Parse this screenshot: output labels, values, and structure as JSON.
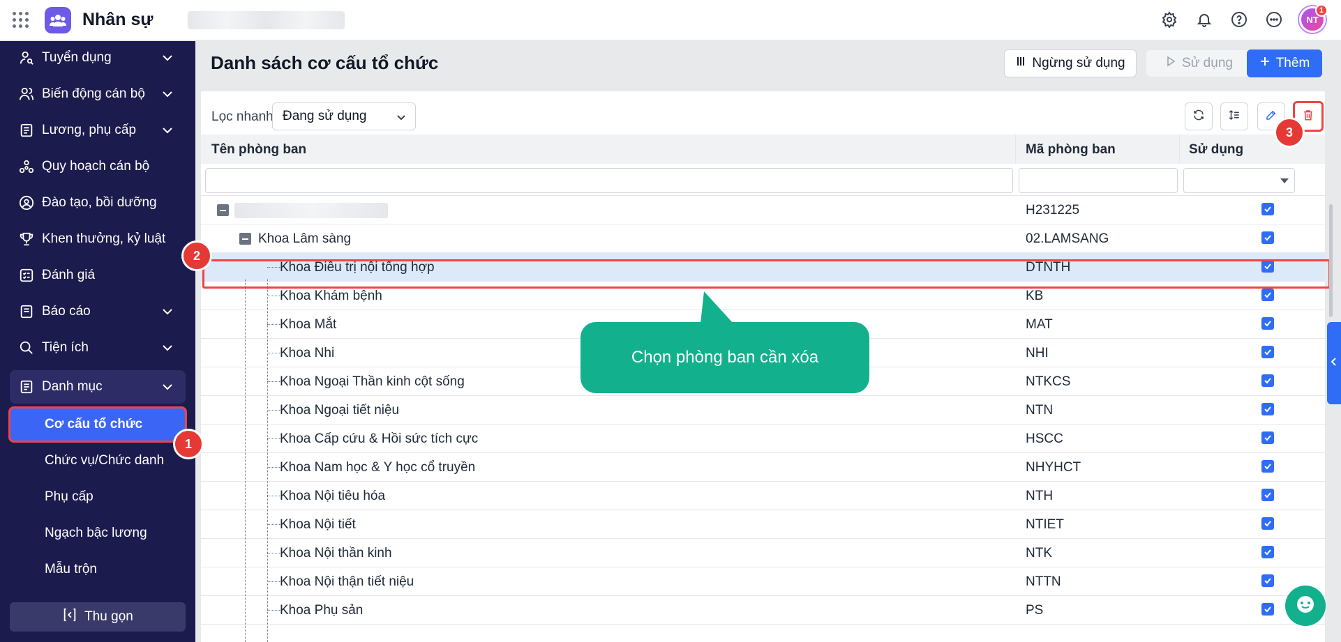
{
  "app": {
    "title": "Nhân sự",
    "avatar_initials": "NT",
    "avatar_badge": "1"
  },
  "sidebar": {
    "items": [
      {
        "label": "Tuyển dụng",
        "icon": "user-search-icon",
        "has_chevron": true
      },
      {
        "label": "Biến động cán bộ",
        "icon": "users-icon",
        "has_chevron": true
      },
      {
        "label": "Lương, phụ cấp",
        "icon": "document-icon",
        "has_chevron": true
      },
      {
        "label": "Quy hoạch cán bộ",
        "icon": "org-icon",
        "has_chevron": false
      },
      {
        "label": "Đào tạo, bồi dưỡng",
        "icon": "user-badge-icon",
        "has_chevron": false
      },
      {
        "label": "Khen thưởng, kỷ luật",
        "icon": "trophy-icon",
        "has_chevron": false
      },
      {
        "label": "Đánh giá",
        "icon": "checklist-icon",
        "has_chevron": false
      },
      {
        "label": "Báo cáo",
        "icon": "report-icon",
        "has_chevron": true
      },
      {
        "label": "Tiện ích",
        "icon": "search-icon",
        "has_chevron": true
      },
      {
        "label": "Danh mục",
        "icon": "list-icon",
        "has_chevron": true,
        "open": true
      }
    ],
    "sub_items": [
      {
        "label": "Cơ cấu tổ chức",
        "active": true
      },
      {
        "label": "Chức vụ/Chức danh"
      },
      {
        "label": "Phụ cấp"
      },
      {
        "label": "Ngạch bậc lương"
      },
      {
        "label": "Mẫu trộn"
      }
    ],
    "collapse_label": "Thu gọn"
  },
  "page": {
    "title": "Danh sách cơ cấu tổ chức",
    "buttons": {
      "stop": "Ngừng sử dụng",
      "use": "Sử dụng",
      "add": "Thêm"
    },
    "filter": {
      "label": "Lọc nhanh",
      "value": "Đang sử dụng"
    }
  },
  "table": {
    "columns": [
      "Tên phòng ban",
      "Mã phòng ban",
      "Sử dụng"
    ],
    "rows": [
      {
        "name": "",
        "code": "H231225",
        "level": 0,
        "checked": true
      },
      {
        "name": "Khoa Lâm sàng",
        "code": "02.LAMSANG",
        "level": 1,
        "checked": true
      },
      {
        "name": "Khoa Điều trị nội tổng hợp",
        "code": "DTNTH",
        "level": 2,
        "checked": true,
        "selected": true
      },
      {
        "name": "Khoa Khám bệnh",
        "code": "KB",
        "level": 2,
        "checked": true
      },
      {
        "name": "Khoa Mắt",
        "code": "MAT",
        "level": 2,
        "checked": true
      },
      {
        "name": "Khoa Nhi",
        "code": "NHI",
        "level": 2,
        "checked": true
      },
      {
        "name": "Khoa Ngoại Thần kinh cột sống",
        "code": "NTKCS",
        "level": 2,
        "checked": true
      },
      {
        "name": "Khoa Ngoại tiết niệu",
        "code": "NTN",
        "level": 2,
        "checked": true
      },
      {
        "name": "Khoa Cấp cứu & Hồi sức tích cực",
        "code": "HSCC",
        "level": 2,
        "checked": true
      },
      {
        "name": "Khoa Nam học & Y học cổ truyền",
        "code": "NHYHCT",
        "level": 2,
        "checked": true
      },
      {
        "name": "Khoa Nội tiêu hóa",
        "code": "NTH",
        "level": 2,
        "checked": true
      },
      {
        "name": "Khoa Nội tiết",
        "code": "NTIET",
        "level": 2,
        "checked": true
      },
      {
        "name": "Khoa Nội thần kinh",
        "code": "NTK",
        "level": 2,
        "checked": true
      },
      {
        "name": "Khoa Nội thận tiết niệu",
        "code": "NTTN",
        "level": 2,
        "checked": true
      },
      {
        "name": "Khoa Phụ sản",
        "code": "PS",
        "level": 2,
        "checked": true
      }
    ]
  },
  "annotations": {
    "callout": "Chọn phòng ban cần xóa",
    "steps": [
      "1",
      "2",
      "3"
    ]
  },
  "colors": {
    "sidebar_bg": "#1c1b4d",
    "accent": "#2f6df6",
    "callout": "#13b08d",
    "highlight": "#ef4444"
  }
}
